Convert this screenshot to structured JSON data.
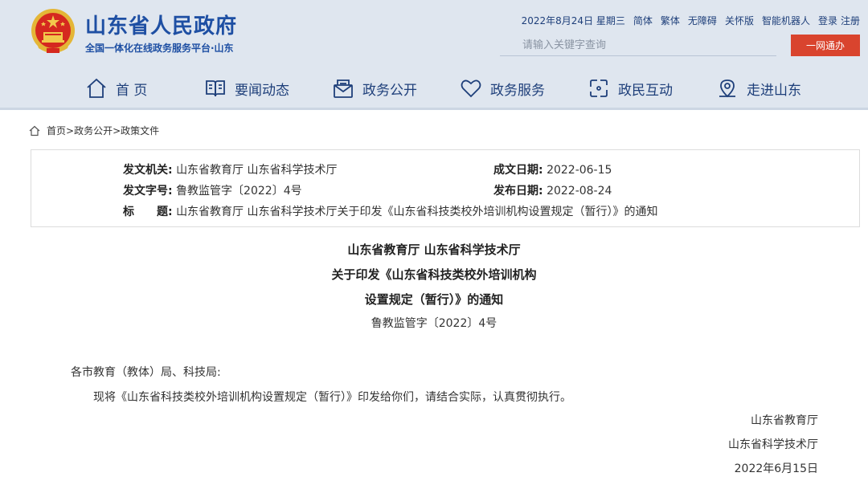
{
  "site": {
    "title": "山东省人民政府",
    "subtitle": "全国一体化在线政务服务平台·山东"
  },
  "topbar": {
    "date": "2022年8月24日 星期三",
    "links": [
      "简体",
      "繁体",
      "无障碍",
      "关怀版",
      "智能机器人",
      "登录",
      "注册"
    ]
  },
  "search": {
    "placeholder": "请输入关键字查询",
    "button_label": "一网通办"
  },
  "nav": [
    {
      "label": "首 页",
      "icon": "home-icon"
    },
    {
      "label": "要闻动态",
      "icon": "book-icon"
    },
    {
      "label": "政务公开",
      "icon": "mail-icon"
    },
    {
      "label": "政务服务",
      "icon": "heart-icon"
    },
    {
      "label": "政民互动",
      "icon": "interaction-icon"
    },
    {
      "label": "走进山东",
      "icon": "location-icon"
    }
  ],
  "breadcrumb": [
    "首页",
    "政务公开",
    "政策文件"
  ],
  "meta": {
    "issuer_key": "发文机关:",
    "issuer_value": "山东省教育厅 山东省科学技术厅",
    "date_created_key": "成文日期:",
    "date_created_value": "2022-06-15",
    "doc_no_key": "发文字号:",
    "doc_no_value": "鲁教监管字〔2022〕4号",
    "date_published_key": "发布日期:",
    "date_published_value": "2022-08-24",
    "title_key": "标　　题:",
    "title_value": "山东省教育厅 山东省科学技术厅关于印发《山东省科技类校外培训机构设置规定（暂行）》的通知"
  },
  "document": {
    "title_lines": [
      "山东省教育厅 山东省科学技术厅",
      "关于印发《山东省科技类校外培训机构",
      "设置规定（暂行）》的通知"
    ],
    "number": "鲁教监管字〔2022〕4号",
    "salutation": "各市教育（教体）局、科技局:",
    "paragraph": "现将《山东省科技类校外培训机构设置规定（暂行）》印发给你们，请结合实际，认真贯彻执行。",
    "signatures": [
      "山东省教育厅",
      "山东省科学技术厅",
      "2022年6月15日"
    ]
  }
}
